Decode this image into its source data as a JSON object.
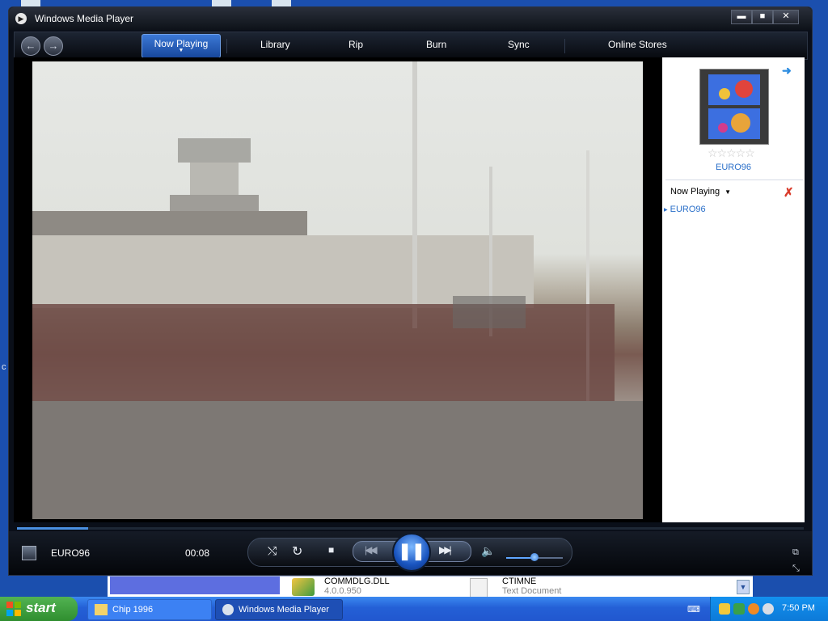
{
  "window": {
    "title": "Windows Media Player",
    "minimize_glyph": "▬",
    "maximize_glyph": "■",
    "close_glyph": "✕"
  },
  "nav": {
    "back_glyph": "←",
    "forward_glyph": "→",
    "tabs": [
      {
        "label": "Now Playing",
        "active": true
      },
      {
        "label": "Library"
      },
      {
        "label": "Rip"
      },
      {
        "label": "Burn"
      },
      {
        "label": "Sync"
      },
      {
        "label": "Online Stores"
      }
    ]
  },
  "playlist_pane": {
    "album_title": "EURO96",
    "rating_stars": "☆☆☆☆☆",
    "rating": 0,
    "list_name": "Now Playing",
    "items": [
      "EURO96"
    ]
  },
  "player": {
    "title": "EURO96",
    "time": "00:08",
    "seek_progress_percent": 9,
    "volume_percent": 50,
    "icons": {
      "shuffle": "shuffle-icon",
      "repeat": "repeat-icon",
      "stop": "stop-icon",
      "previous": "previous-icon",
      "pause": "pause-icon",
      "next": "next-icon",
      "mute": "speaker-icon",
      "compact_mode": "switch-to-skin-icon",
      "full_screen": "full-screen-icon"
    }
  },
  "background_window": {
    "file_name": "COMMDLG.DLL",
    "file_version": "4.0.0.950",
    "doc_name": "CTIMNE",
    "doc_type": "Text Document"
  },
  "taskbar": {
    "start_label": "start",
    "tasks": [
      {
        "label": "Chip 1996"
      },
      {
        "label": "Windows Media Player"
      }
    ],
    "clock": "7:50 PM"
  },
  "colors": {
    "wmp_chrome": "#0a0f19",
    "accent_blue": "#2a6fc9",
    "taskbar_blue": "#2460d6",
    "start_green": "#3a9d3a"
  }
}
